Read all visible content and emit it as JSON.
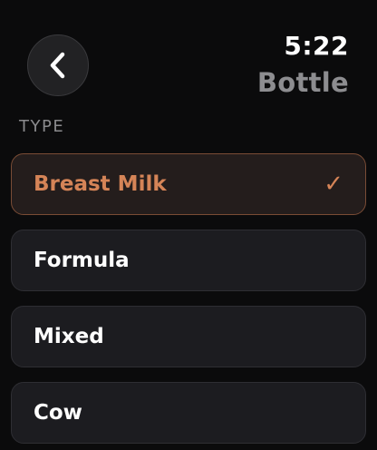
{
  "header": {
    "back_icon": "chevron-left-icon",
    "time": "5:22",
    "title": "Bottle"
  },
  "type_section": {
    "label": "TYPE",
    "options": [
      {
        "label": "Breast Milk",
        "selected": true
      },
      {
        "label": "Formula",
        "selected": false
      },
      {
        "label": "Mixed",
        "selected": false
      },
      {
        "label": "Cow",
        "selected": false
      }
    ],
    "check_glyph": "✓"
  },
  "colors": {
    "background": "#0b0b0c",
    "accent": "#d58457",
    "selected_border": "#7a4c35",
    "option_bg": "#1c1c20",
    "muted_text": "#8d8d90"
  }
}
